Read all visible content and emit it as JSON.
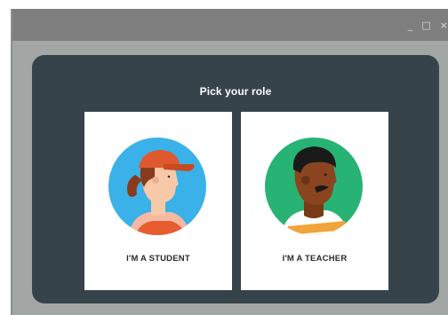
{
  "window": {
    "minimize_label": "_",
    "maximize_label": "□",
    "close_label": "×"
  },
  "dialog": {
    "title": "Pick your role",
    "roles": [
      {
        "label": "I'M A STUDENT",
        "icon": "student-avatar-icon"
      },
      {
        "label": "I'M A TEACHER",
        "icon": "teacher-avatar-icon"
      }
    ]
  },
  "colors": {
    "window_bg": "#a2a6a4",
    "titlebar": "#7e7e7e",
    "dialog_bg": "#37434a",
    "card_bg": "#ffffff",
    "student_circle": "#3ab1e8",
    "teacher_circle": "#27b373",
    "cap": "#e0592e"
  }
}
